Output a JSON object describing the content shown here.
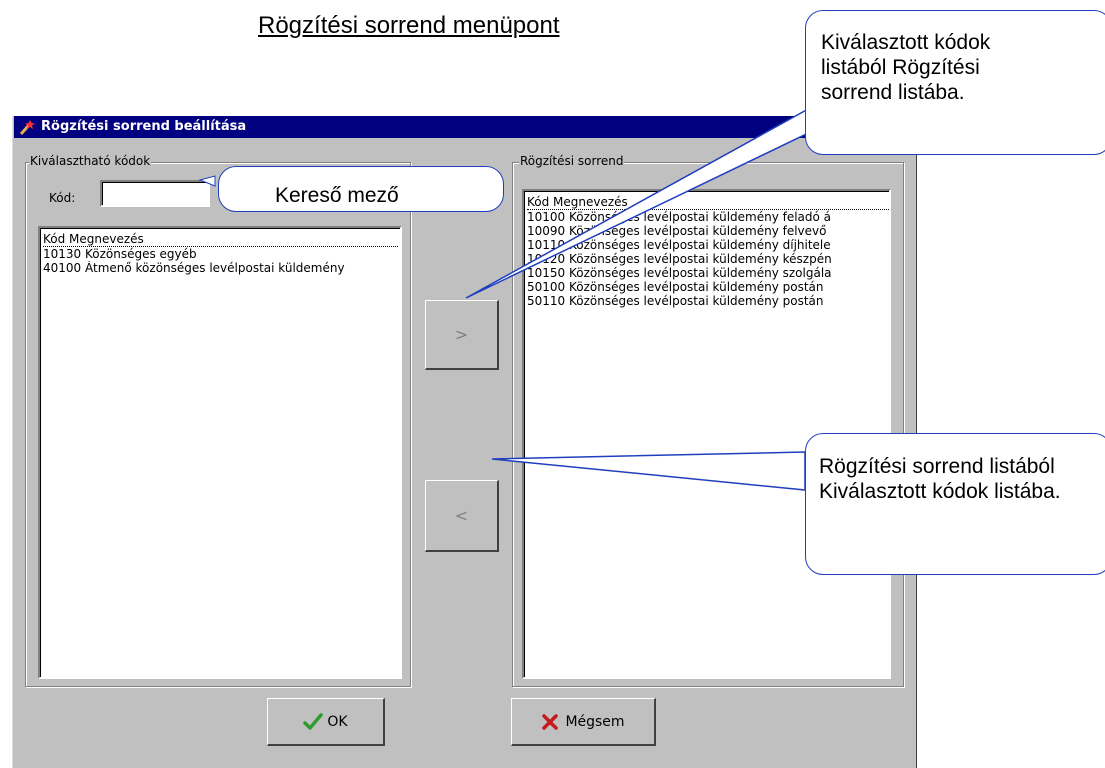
{
  "heading": "Rögzítési sorrend menüpont",
  "window": {
    "title": "Rögzítési sorrend beállítása"
  },
  "left_group": {
    "label": "Kiválasztható kódok",
    "code_label": "Kód:",
    "code_value": "",
    "list_header": "Kód  Megnevezés",
    "items": [
      "10130 Közönséges egyéb",
      "40100 Átmenő közönséges levélpostai küldemény"
    ]
  },
  "right_group": {
    "label": "Rögzítési sorrend",
    "list_header": "Kód  Megnevezés",
    "items": [
      "10100 Közönséges levélpostai küldemény feladó á",
      "10090 Közönséges levélpostai küldemény felvevő",
      "10110 Közönséges levélpostai küldemény díjhitele",
      "10120 Közönséges levélpostai küldemény készpén",
      "10150 Közönséges levélpostai küldemény szolgála",
      "50100 Közönséges levélpostai küldemény postán",
      "50110 Közönséges levélpostai küldemény postán"
    ]
  },
  "buttons": {
    "add": ">",
    "remove": "<",
    "ok": "OK",
    "cancel": "Mégsem"
  },
  "callouts": {
    "search": "Kereső mező",
    "add": "Kiválasztott kódok listából Rögzítési sorrend listába.",
    "remove": "Rögzítési sorrend listából Kiválasztott kódok listába."
  },
  "colors": {
    "titlebar": "#000080",
    "dialog_bg": "#c0c0c0",
    "callout_border": "#1f3fbf",
    "ok_check": "#2e9b2e",
    "cancel_x": "#c41a1a"
  },
  "icons": [
    "wand-icon",
    "check-icon",
    "x-icon"
  ]
}
